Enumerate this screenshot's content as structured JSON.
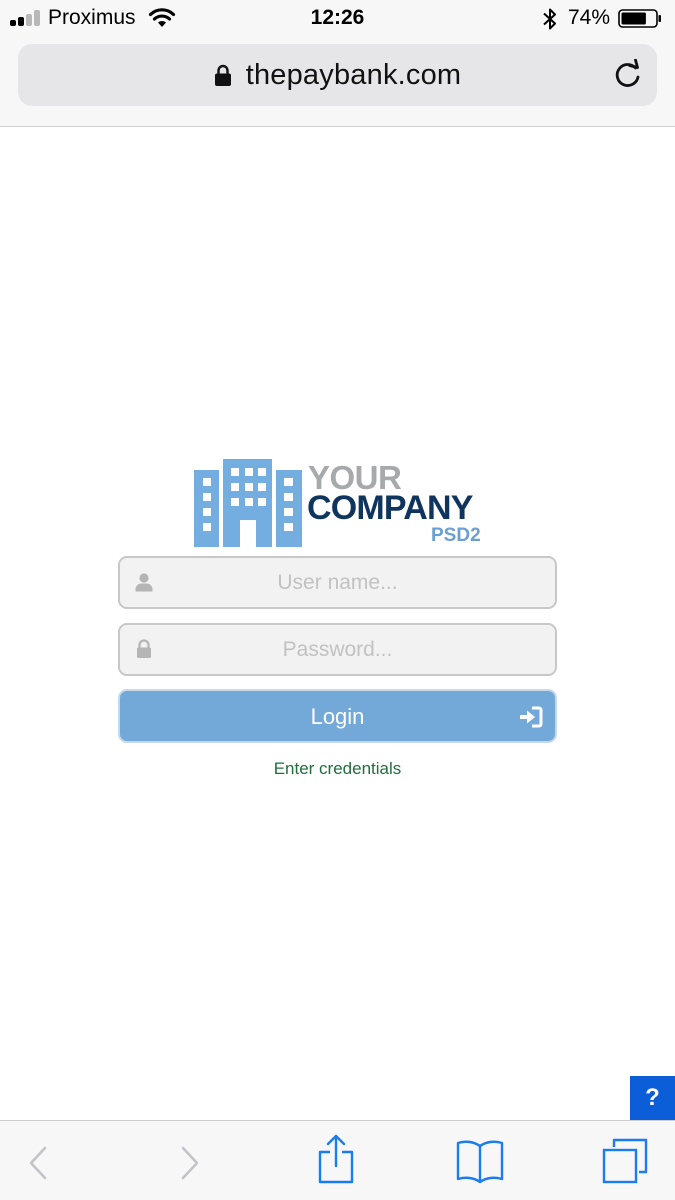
{
  "status_bar": {
    "carrier": "Proximus",
    "time": "12:26",
    "battery_percent": "74%",
    "battery_level": 0.74,
    "signal_bars_filled": 2,
    "signal_bars_total": 4,
    "icons": [
      "signal-icon",
      "wifi-icon",
      "bluetooth-icon",
      "battery-icon"
    ]
  },
  "browser": {
    "url": "thepaybank.com",
    "secure": true,
    "toolbar_icons": [
      "back-icon",
      "forward-icon",
      "share-icon",
      "bookmarks-icon",
      "tabs-icon"
    ]
  },
  "logo": {
    "line1": "YOUR",
    "line2": "COMPANY",
    "line3": "PSD2"
  },
  "login_form": {
    "username_placeholder": "User name...",
    "password_placeholder": "Password...",
    "login_label": "Login",
    "status_message": "Enter credentials"
  },
  "help": {
    "label": "?"
  },
  "colors": {
    "logo_gray": "#a7a9ac",
    "logo_navy": "#0f355f",
    "logo_blue": "#6a9fd3",
    "building_blue": "#74aee0",
    "login_button": "#73a9d9",
    "status_message": "#1f6e3c",
    "help_button": "#0b5ed7",
    "ios_blue": "#1a7cf0"
  }
}
